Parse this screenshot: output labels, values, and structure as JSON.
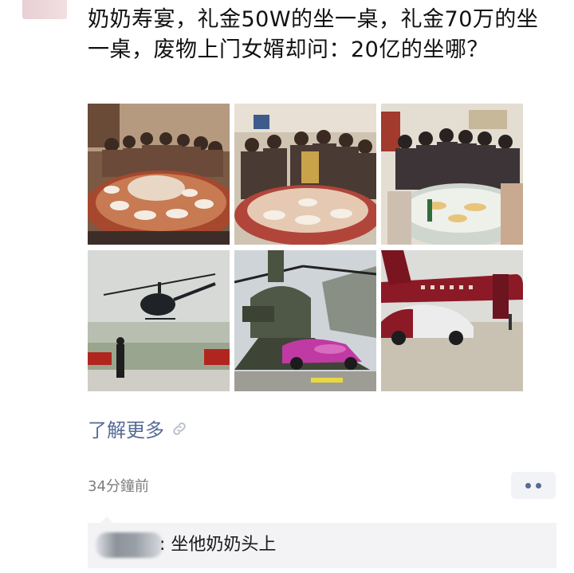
{
  "post": {
    "text": "奶奶寿宴，礼金50W的坐一桌，礼金70万的坐一桌，废物上门女婿却问：20亿的坐哪？",
    "images": [
      {
        "name": "banquet-photo-1",
        "description_icon": "photo-icon"
      },
      {
        "name": "banquet-photo-2",
        "description_icon": "photo-icon"
      },
      {
        "name": "banquet-photo-3",
        "description_icon": "photo-icon"
      },
      {
        "name": "helicopter-photo",
        "description_icon": "photo-icon"
      },
      {
        "name": "chinook-car-photo",
        "description_icon": "photo-icon"
      },
      {
        "name": "jet-car-photo",
        "description_icon": "photo-icon"
      }
    ],
    "more_link_label": "了解更多",
    "link_icon": "link-icon",
    "timestamp": "34分鐘前"
  },
  "comment": {
    "text": ": 坐他奶奶头上"
  },
  "colors": {
    "link": "#576b95",
    "comment_bg": "#f3f3f5",
    "timestamp": "#7c7c7c"
  }
}
